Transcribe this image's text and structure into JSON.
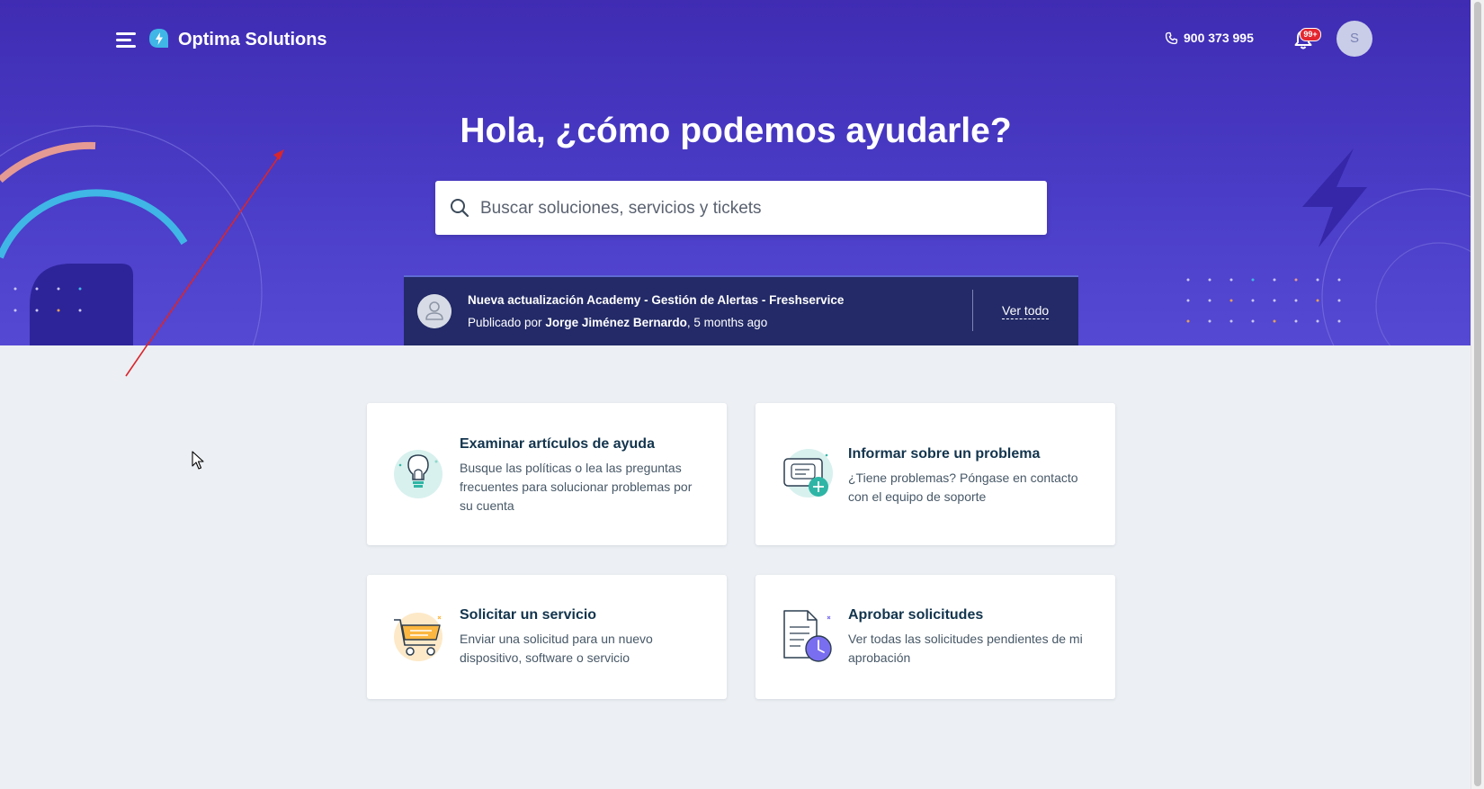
{
  "header": {
    "brand_name": "Optima Solutions",
    "phone": "900 373 995",
    "notification_badge": "99+",
    "avatar_initial": "S"
  },
  "hero": {
    "title": "Hola, ¿cómo podemos ayudarle?",
    "search_placeholder": "Buscar soluciones, servicios y tickets"
  },
  "announcement": {
    "title": "Nueva actualización Academy - Gestión de Alertas - Freshservice",
    "published_prefix": "Publicado por",
    "author": "Jorge Jiménez Bernardo",
    "time": ", 5 months ago",
    "view_all": "Ver todo"
  },
  "cards": [
    {
      "title": "Examinar artículos de ayuda",
      "description": "Busque las políticas o lea las preguntas frecuentes para solucionar problemas por su cuenta",
      "icon": "lightbulb-icon"
    },
    {
      "title": "Informar sobre un problema",
      "description": "¿Tiene problemas? Póngase en contacto con el equipo de soporte",
      "icon": "report-ticket-icon"
    },
    {
      "title": "Solicitar un servicio",
      "description": "Enviar una solicitud para un nuevo dispositivo, software o servicio",
      "icon": "shopping-cart-icon"
    },
    {
      "title": "Aprobar solicitudes",
      "description": "Ver todas las solicitudes pendientes de mi aprobación",
      "icon": "document-clock-icon"
    }
  ],
  "colors": {
    "hero_top": "#3f2cb3",
    "hero_bottom": "#5549d3",
    "announcement_bg": "#232a67",
    "page_bg": "#eceff3",
    "title_text": "#12344d"
  }
}
